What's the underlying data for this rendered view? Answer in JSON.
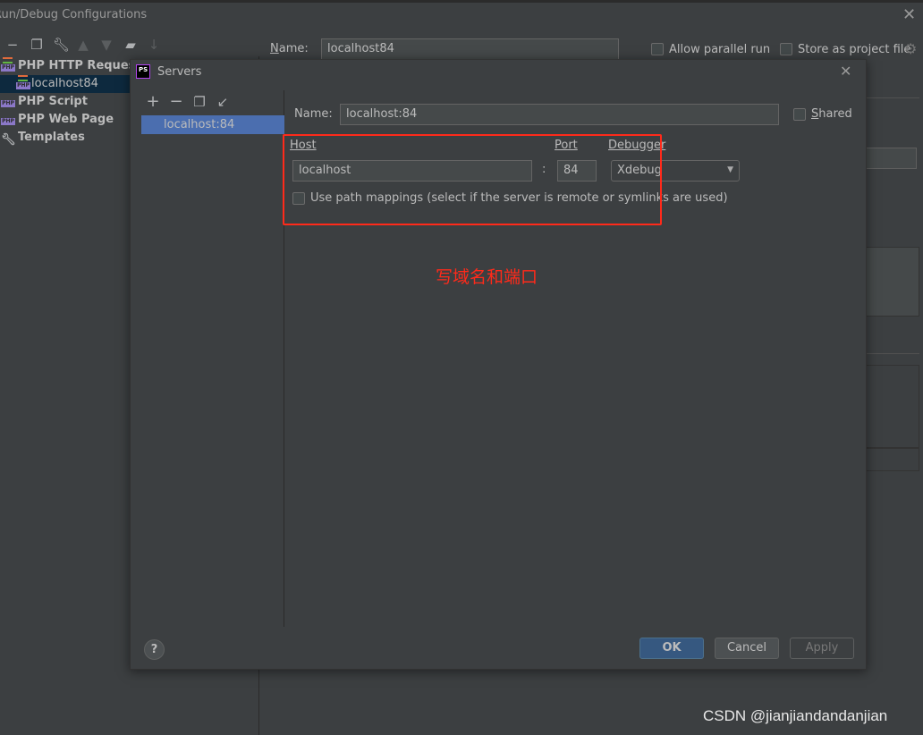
{
  "window": {
    "title": "Run/Debug Configurations"
  },
  "toolbar": {
    "icons": [
      "minus-icon",
      "copy-icon",
      "wrench-icon",
      "arrow-up-icon",
      "arrow-down-icon",
      "new-folder-icon",
      "sort-icon"
    ]
  },
  "tree": {
    "items": [
      {
        "label": "PHP HTTP Request",
        "level": 0
      },
      {
        "label": "localhost84",
        "level": 1,
        "selected": true
      },
      {
        "label": "PHP Script",
        "level": 0
      },
      {
        "label": "PHP Web Page",
        "level": 0
      },
      {
        "label": "Templates",
        "level": 0
      }
    ]
  },
  "config": {
    "name_label": "Name:",
    "name_value": "localhost84",
    "allow_parallel": "Allow parallel run",
    "store_project": "Store as project file"
  },
  "servers_dialog": {
    "title": "Servers",
    "list": [
      "localhost:84"
    ],
    "name_label": "Name:",
    "name_value": "localhost:84",
    "shared_label": "Shared",
    "host_label": "Host",
    "host_value": "localhost",
    "colon": ":",
    "port_label": "Port",
    "port_value": "84",
    "debugger_label": "Debugger",
    "debugger_value": "Xdebug",
    "path_mappings_label": "Use path mappings (select if the server is remote or symlinks are used)",
    "ok": "OK",
    "cancel": "Cancel",
    "apply": "Apply",
    "help": "?"
  },
  "annotation": {
    "text": "写域名和端口",
    "color": "#ff2a1a"
  },
  "watermark": "CSDN @jianjiandandanjian",
  "colors": {
    "background": "#3c3f41",
    "selection": "#4b6eaf",
    "tree_selection": "#0d293e",
    "primary_button": "#365880"
  }
}
